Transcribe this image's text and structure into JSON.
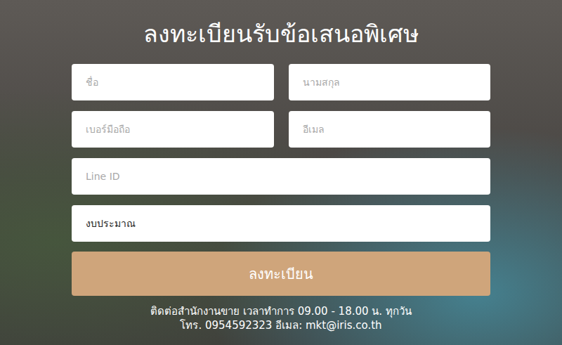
{
  "form": {
    "title": "ลงทะเบียนรับข้อเสนอพิเศษ",
    "rows": [
      [
        {
          "kind": "text",
          "placeholder": "ชื่อ"
        },
        {
          "kind": "text",
          "placeholder": "นามสกุล"
        }
      ],
      [
        {
          "kind": "text",
          "placeholder": "เบอร์มือถือ"
        },
        {
          "kind": "text",
          "placeholder": "อีเมล"
        }
      ],
      [
        {
          "kind": "text",
          "placeholder": "Line ID"
        }
      ],
      [
        {
          "kind": "select",
          "placeholder": "งบประมาณ"
        }
      ]
    ],
    "submit": "ลงทะเบียน"
  },
  "footer": {
    "lines": [
      "ติดต่อสำนักงานขาย เวลาทำการ 09.00 - 18.00 น. ทุกวัน",
      "โทร. 0954592323 อีเมล: mkt@iris.co.th"
    ]
  }
}
